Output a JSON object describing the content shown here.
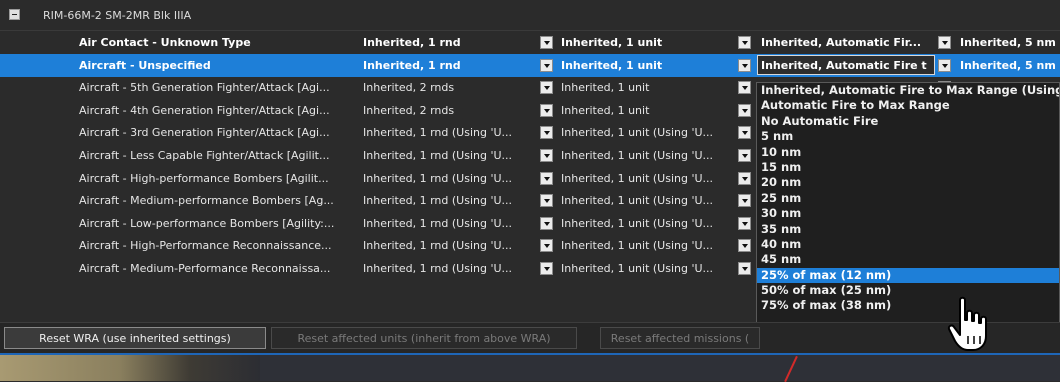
{
  "group": {
    "title": "RIM-66M-2 SM-2MR Blk IIIA"
  },
  "rows": [
    {
      "name": "Air Contact - Unknown Type",
      "weapons": "Inherited, 1 rnd",
      "targets": "Inherited, 1 unit",
      "auto_fire": "Inherited, Automatic Fir...",
      "range": "Inherited, 5 nm"
    },
    {
      "name": "Aircraft - Unspecified",
      "weapons": "Inherited, 1 rnd",
      "targets": "Inherited, 1 unit",
      "auto_fire": "Inherited, Automatic Fire t",
      "range": "Inherited, 5 nm"
    },
    {
      "name": "Aircraft - 5th Generation Fighter/Attack [Agi...",
      "weapons": "Inherited, 2 rnds",
      "targets": "Inherited, 1 unit"
    },
    {
      "name": "Aircraft - 4th Generation Fighter/Attack [Agi...",
      "weapons": "Inherited, 2 rnds",
      "targets": "Inherited, 1 unit"
    },
    {
      "name": "Aircraft - 3rd Generation Fighter/Attack [Agi...",
      "weapons": "Inherited, 1 rnd (Using 'U...",
      "targets": "Inherited, 1 unit (Using 'U..."
    },
    {
      "name": "Aircraft - Less Capable Fighter/Attack [Agilit...",
      "weapons": "Inherited, 1 rnd (Using 'U...",
      "targets": "Inherited, 1 unit (Using 'U..."
    },
    {
      "name": "Aircraft - High-performance Bombers [Agilit...",
      "weapons": "Inherited, 1 rnd (Using 'U...",
      "targets": "Inherited, 1 unit (Using 'U..."
    },
    {
      "name": "Aircraft - Medium-performance Bombers [Ag...",
      "weapons": "Inherited, 1 rnd (Using 'U...",
      "targets": "Inherited, 1 unit (Using 'U..."
    },
    {
      "name": "Aircraft - Low-performance Bombers [Agility:...",
      "weapons": "Inherited, 1 rnd (Using 'U...",
      "targets": "Inherited, 1 unit (Using 'U..."
    },
    {
      "name": "Aircraft - High-Performance Reconnaissance...",
      "weapons": "Inherited, 1 rnd (Using 'U...",
      "targets": "Inherited, 1 unit (Using 'U..."
    },
    {
      "name": "Aircraft - Medium-Performance Reconnaissa...",
      "weapons": "Inherited, 1 rnd (Using 'U...",
      "targets": "Inherited, 1 unit (Using 'U..."
    }
  ],
  "dropdown": {
    "options": [
      "Inherited, Automatic Fire to Max Range (Using",
      "Automatic Fire to Max Range",
      "No Automatic Fire",
      "5 nm",
      "10 nm",
      "15 nm",
      "20 nm",
      "25 nm",
      "30 nm",
      "35 nm",
      "40 nm",
      "45 nm",
      "25% of max (12 nm)",
      "50% of max (25 nm)",
      "75% of max (38 nm)"
    ],
    "highlighted_index": 12
  },
  "buttons": {
    "reset_wra": "Reset WRA (use inherited settings)",
    "reset_units": "Reset affected units (inherit from above WRA)",
    "reset_missions": "Reset affected missions ("
  },
  "colors": {
    "selection": "#1e7fd8",
    "background": "#2b2b2b"
  },
  "cursor": {
    "icon": "hand-pointer-icon"
  }
}
